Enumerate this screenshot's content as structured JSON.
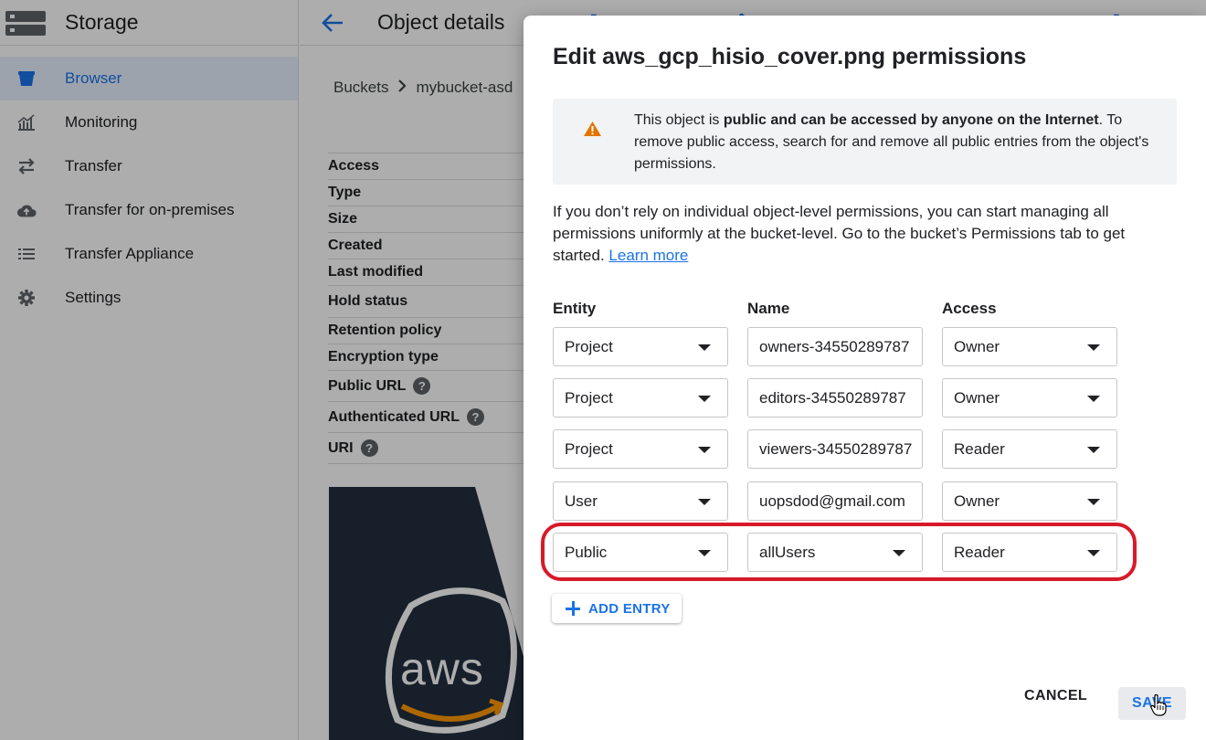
{
  "app": {
    "title": "Storage"
  },
  "sidebar": {
    "items": [
      {
        "label": "Browser",
        "icon": "bucket-icon",
        "active": true
      },
      {
        "label": "Monitoring",
        "icon": "chart-icon"
      },
      {
        "label": "Transfer",
        "icon": "swap-arrows-icon"
      },
      {
        "label": "Transfer for on-premises",
        "icon": "cloud-upload-icon"
      },
      {
        "label": "Transfer Appliance",
        "icon": "list-icon"
      },
      {
        "label": "Settings",
        "icon": "gear-icon"
      }
    ]
  },
  "main": {
    "title": "Object details",
    "breadcrumb": [
      "Buckets",
      "mybucket-asd"
    ],
    "details": [
      "Access",
      "Type",
      "Size",
      "Created",
      "Last modified",
      "Hold status",
      "Retention policy",
      "Encryption type",
      "Public URL",
      "Authenticated URL",
      "URI"
    ],
    "preview_text": "aws"
  },
  "dialog": {
    "title": "Edit aws_gcp_hisio_cover.png permissions",
    "warning": {
      "prefix": "This object is ",
      "bold": "public and can be accessed by anyone on the Internet",
      "suffix": ". To remove public access, search for and remove all public entries from the object's permissions."
    },
    "info": {
      "text": "If you don’t rely on individual object-level permissions, you can start managing all permissions uniformly at the bucket-level. Go to the bucket’s Permissions tab to get started. ",
      "link": "Learn more"
    },
    "columns": {
      "entity": "Entity",
      "name": "Name",
      "access": "Access"
    },
    "entries": [
      {
        "entity": "Project",
        "name": "owners-34550289787",
        "access": "Owner"
      },
      {
        "entity": "Project",
        "name": "editors-34550289787",
        "access": "Owner"
      },
      {
        "entity": "Project",
        "name": "viewers-34550289787",
        "access": "Reader"
      },
      {
        "entity": "User",
        "name": "uopsdod@gmail.com",
        "access": "Owner"
      },
      {
        "entity": "Public",
        "name": "allUsers",
        "access": "Reader"
      }
    ],
    "add_entry": "ADD ENTRY",
    "cancel": "CANCEL",
    "save": "SAVE"
  },
  "colors": {
    "accent": "#1a73e8",
    "highlight": "#d71a2a",
    "warning": "#e37400"
  }
}
